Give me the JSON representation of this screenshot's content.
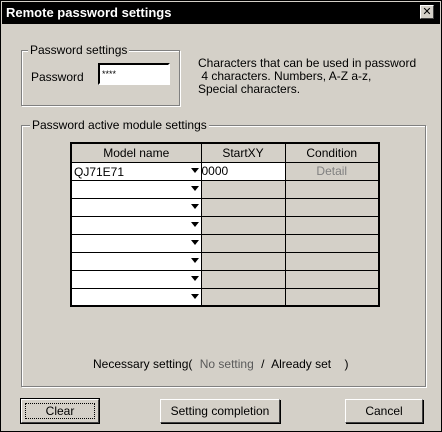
{
  "window": {
    "title": "Remote password settings",
    "close_glyph": "✕"
  },
  "password_group": {
    "legend": "Password settings",
    "label": "Password",
    "value": "****"
  },
  "info_lines": [
    "Characters that can be used in password",
    " 4 characters. Numbers, A-Z a-z,",
    "Special characters."
  ],
  "module_group": {
    "legend": "Password active module settings",
    "columns": [
      "Model name",
      "StartXY",
      "Condition"
    ],
    "rows": [
      {
        "model": "QJ71E71",
        "start": "0000",
        "condition": "Detail"
      },
      {
        "model": "",
        "start": "",
        "condition": ""
      },
      {
        "model": "",
        "start": "",
        "condition": ""
      },
      {
        "model": "",
        "start": "",
        "condition": ""
      },
      {
        "model": "",
        "start": "",
        "condition": ""
      },
      {
        "model": "",
        "start": "",
        "condition": ""
      },
      {
        "model": "",
        "start": "",
        "condition": ""
      },
      {
        "model": "",
        "start": "",
        "condition": ""
      }
    ]
  },
  "necessary": {
    "prefix": "Necessary setting(",
    "no_setting": "No setting",
    "slash": "/",
    "already_set": "Already set",
    "suffix": ")"
  },
  "buttons": {
    "clear": "Clear",
    "setting_completion": "Setting completion",
    "cancel": "Cancel"
  },
  "colors": {
    "titlebar": "#000000",
    "dialog": "#d4d0c8"
  }
}
